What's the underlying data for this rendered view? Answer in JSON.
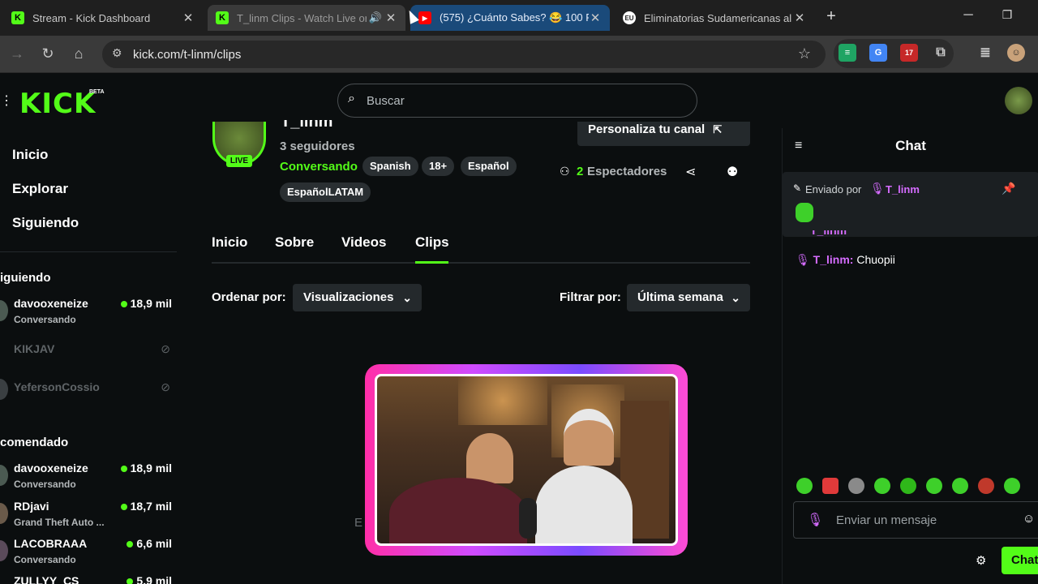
{
  "browser": {
    "tabs": [
      {
        "title": "Stream - Kick Dashboard",
        "favicon": "K"
      },
      {
        "title": "T_linm Clips - Watch Live or",
        "favicon": "K"
      },
      {
        "title": "(575) ¿Cuánto Sabes? 😂 100 F",
        "favicon": "▶"
      },
      {
        "title": "Eliminatorias Sudamericanas al",
        "favicon": "EU"
      }
    ],
    "new_tab": "+",
    "url": "kick.com/t-linm/clips",
    "extension_badge": "17"
  },
  "kick": {
    "logo": "KICK",
    "beta": "BETA",
    "search_placeholder": "Buscar"
  },
  "sidebar": {
    "nav": [
      "Inicio",
      "Explorar",
      "Siguiendo"
    ],
    "following_header": "iguiendo",
    "following": [
      {
        "name": "davooxeneize",
        "sub": "Conversando",
        "viewers": "18,9 mil",
        "live": true
      },
      {
        "name": "KIKJAV",
        "sub": "",
        "viewers": "",
        "live": false
      },
      {
        "name": "YefersonCossio",
        "sub": "",
        "viewers": "",
        "live": false
      }
    ],
    "recommended_header": "comendado",
    "recommended": [
      {
        "name": "davooxeneize",
        "sub": "Conversando",
        "viewers": "18,9 mil"
      },
      {
        "name": "RDjavi",
        "sub": "Grand Theft Auto ...",
        "viewers": "18,7 mil"
      },
      {
        "name": "LACOBRAAA",
        "sub": "Conversando",
        "viewers": "6,6 mil"
      },
      {
        "name": "ZULLYY_CS",
        "sub": "",
        "viewers": "5,9 mil"
      }
    ]
  },
  "channel": {
    "name": "T_linm",
    "followers": "3 seguidores",
    "category": "Conversando",
    "live_badge": "LIVE",
    "tags": [
      "Spanish",
      "18+",
      "Español",
      "EspañolLATAM"
    ],
    "customize_label": "Personaliza tu canal",
    "viewers_count": "2",
    "viewers_label": "Espectadores",
    "tabs": [
      "Inicio",
      "Sobre",
      "Videos",
      "Clips"
    ],
    "sort_label": "Ordenar por:",
    "sort_value": "Visualizaciones",
    "filter_label": "Filtrar por:",
    "filter_value": "Última semana",
    "empty_partial": "E"
  },
  "chat": {
    "title": "Chat",
    "pinned_prefix": "Enviado por",
    "pinned_user": "T_linm",
    "messages": [
      {
        "user": "T_linm",
        "text": "Chuopii"
      }
    ],
    "input_placeholder": "Enviar un mensaje",
    "send_label": "Chat"
  },
  "colors": {
    "kick_green": "#53fc18",
    "background": "#0b0e0f",
    "chat_user": "#d56cff"
  }
}
